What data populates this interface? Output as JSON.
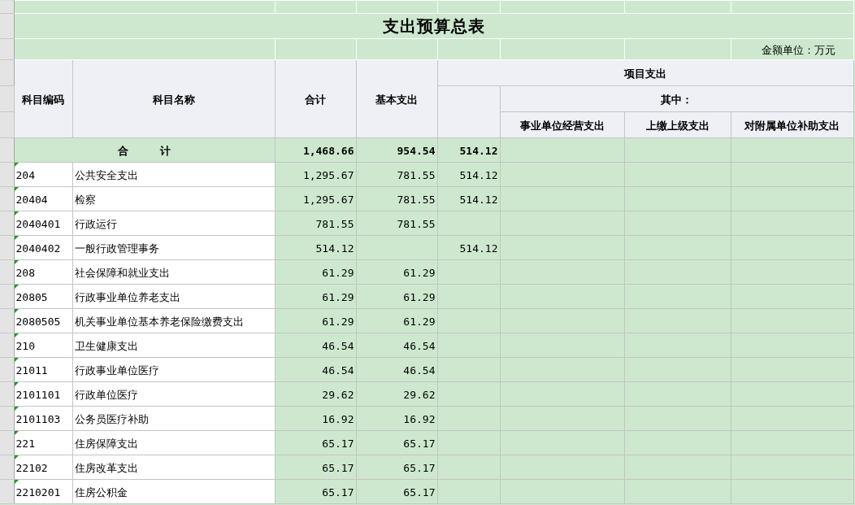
{
  "title": "支出预算总表",
  "unit": "金额单位：万元",
  "columns": {
    "code": "科目编码",
    "name": "科目名称",
    "total": "合计",
    "basic": "基本支出",
    "project": "项目支出",
    "of_which": "其中：",
    "sub": [
      "事业单位经营支出",
      "上缴上级支出",
      "对附属单位补助支出"
    ]
  },
  "total_row": {
    "label": "合　　　计",
    "total": "1,468.66",
    "basic": "954.54",
    "project": "514.12"
  },
  "rows": [
    {
      "code": "204",
      "name": "公共安全支出",
      "total": "1,295.67",
      "basic": "781.55",
      "project": "514.12"
    },
    {
      "code": "20404",
      "name": "检察",
      "total": "1,295.67",
      "basic": "781.55",
      "project": "514.12"
    },
    {
      "code": "2040401",
      "name": "行政运行",
      "total": "781.55",
      "basic": "781.55"
    },
    {
      "code": "2040402",
      "name": "一般行政管理事务",
      "total": "514.12",
      "project": "514.12"
    },
    {
      "code": "208",
      "name": "社会保障和就业支出",
      "total": "61.29",
      "basic": "61.29"
    },
    {
      "code": "20805",
      "name": "行政事业单位养老支出",
      "total": "61.29",
      "basic": "61.29"
    },
    {
      "code": "2080505",
      "name": "机关事业单位基本养老保险缴费支出",
      "total": "61.29",
      "basic": "61.29"
    },
    {
      "code": "210",
      "name": "卫生健康支出",
      "total": "46.54",
      "basic": "46.54"
    },
    {
      "code": "21011",
      "name": "行政事业单位医疗",
      "total": "46.54",
      "basic": "46.54"
    },
    {
      "code": "2101101",
      "name": "行政单位医疗",
      "total": "29.62",
      "basic": "29.62"
    },
    {
      "code": "2101103",
      "name": "公务员医疗补助",
      "total": "16.92",
      "basic": "16.92"
    },
    {
      "code": "221",
      "name": "住房保障支出",
      "total": "65.17",
      "basic": "65.17"
    },
    {
      "code": "22102",
      "name": "住房改革支出",
      "total": "65.17",
      "basic": "65.17"
    },
    {
      "code": "2210201",
      "name": "住房公积金",
      "total": "65.17",
      "basic": "65.17"
    }
  ]
}
